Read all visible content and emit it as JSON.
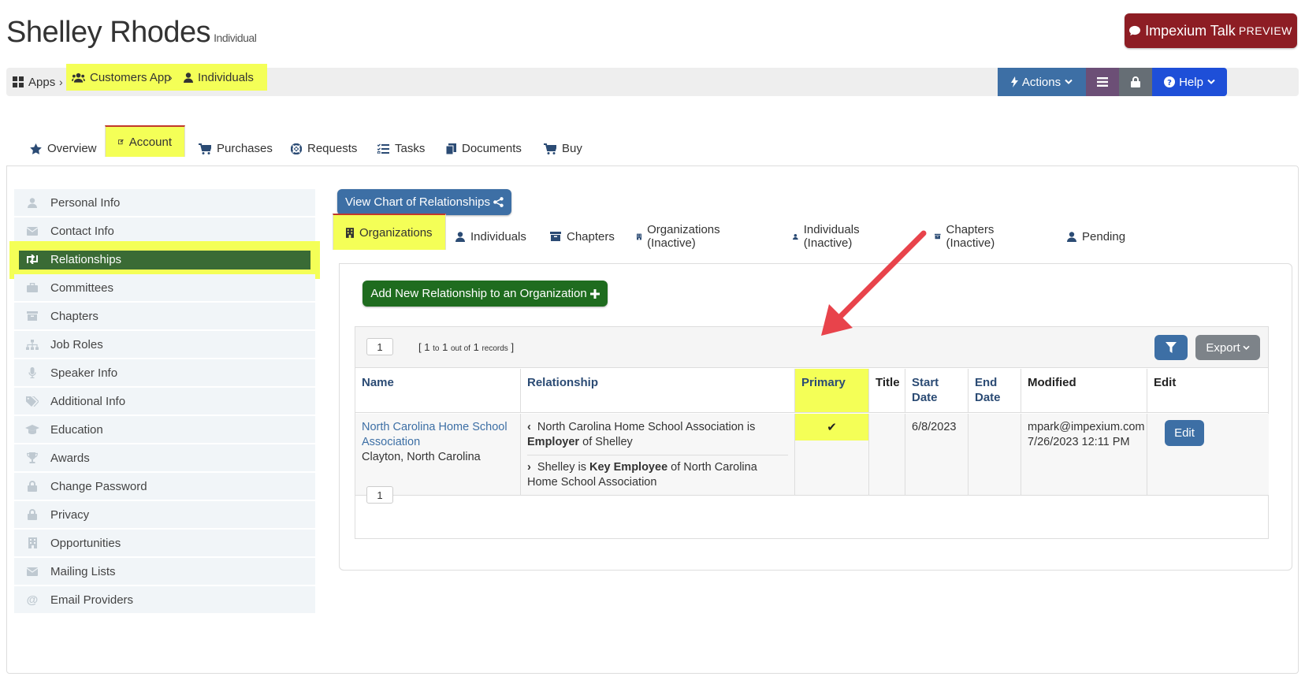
{
  "header": {
    "name": "Shelley Rhodes",
    "type": "Individual",
    "talk_label": "Impexium Talk",
    "talk_suffix": "PREVIEW"
  },
  "breadcrumb": {
    "apps": "Apps",
    "customers_app": "Customers App",
    "individuals": "Individuals"
  },
  "toolbar": {
    "actions": "Actions",
    "help": "Help"
  },
  "main_tabs": [
    "Overview",
    "Account",
    "Purchases",
    "Requests",
    "Tasks",
    "Documents",
    "Buy"
  ],
  "sidenav": [
    {
      "label": "Personal Info",
      "icon": "user-icon"
    },
    {
      "label": "Contact Info",
      "icon": "envelope-icon"
    },
    {
      "label": "Relationships",
      "icon": "retweet-icon"
    },
    {
      "label": "Committees",
      "icon": "briefcase-icon"
    },
    {
      "label": "Chapters",
      "icon": "archive-icon"
    },
    {
      "label": "Job Roles",
      "icon": "sitemap-icon"
    },
    {
      "label": "Speaker Info",
      "icon": "microphone-icon"
    },
    {
      "label": "Additional Info",
      "icon": "tags-icon"
    },
    {
      "label": "Education",
      "icon": "graduation-cap-icon"
    },
    {
      "label": "Awards",
      "icon": "trophy-icon"
    },
    {
      "label": "Change Password",
      "icon": "lock-icon"
    },
    {
      "label": "Privacy",
      "icon": "lock-icon"
    },
    {
      "label": "Opportunities",
      "icon": "building-icon"
    },
    {
      "label": "Mailing Lists",
      "icon": "envelope-icon"
    },
    {
      "label": "Email Providers",
      "icon": "at-icon"
    }
  ],
  "view_chart_label": "View Chart of Relationships",
  "sub_tabs": [
    "Organizations",
    "Individuals",
    "Chapters",
    "Organizations (Inactive)",
    "Individuals (Inactive)",
    "Chapters (Inactive)",
    "Pending"
  ],
  "add_button_label": "Add New Relationship to an Organization",
  "grid": {
    "page": "1",
    "records": {
      "open": "[",
      "from": "1",
      "to_word": "to",
      "to": "1",
      "outof": "out of",
      "total": "1",
      "records_word": "records",
      "close": "]"
    },
    "export_label": "Export",
    "columns": [
      "Name",
      "Relationship",
      "Primary",
      "Title",
      "Start Date",
      "End Date",
      "Modified",
      "Edit"
    ],
    "row": {
      "name": "North Carolina Home School Association",
      "location": "Clayton, North Carolina",
      "rel1_pre": "North Carolina Home School Association is",
      "rel1_bold": "Employer",
      "rel1_post": "of Shelley",
      "rel2_pre": "Shelley is",
      "rel2_bold": "Key Employee",
      "rel2_post": "of North Carolina Home School Association",
      "primary": "✔",
      "title": "",
      "start_date": "6/8/2023",
      "end_date": "",
      "modified_by": "mpark@impexium.com",
      "modified_at": "7/26/2023 12:11 PM",
      "edit_label": "Edit"
    }
  }
}
